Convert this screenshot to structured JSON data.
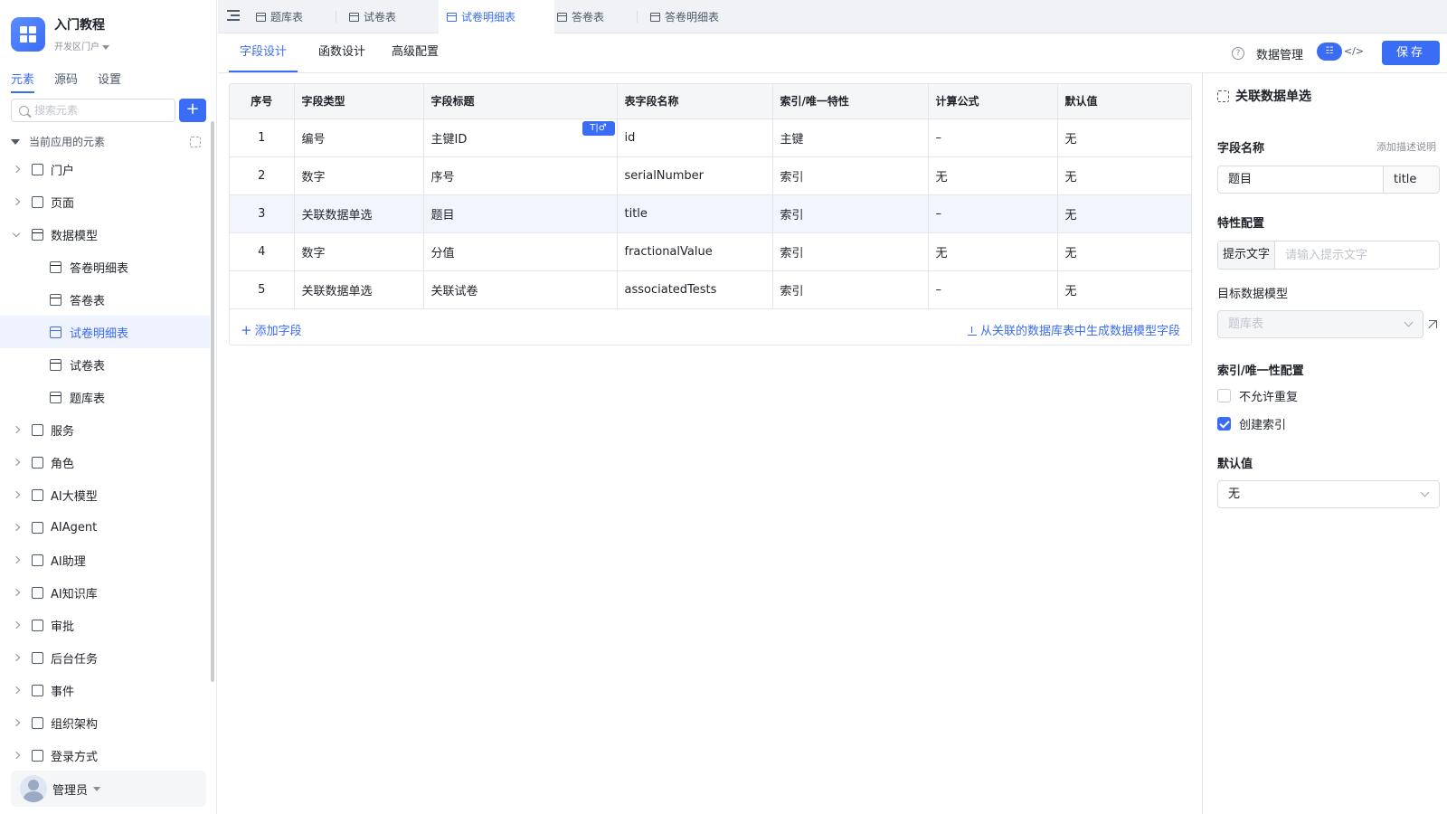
{
  "app": {
    "name": "入门教程",
    "portal": "开发区门户"
  },
  "sidebar": {
    "tabs": [
      "元素",
      "源码",
      "设置"
    ],
    "search_placeholder": "搜索元素",
    "add_label": "+",
    "section_title": "当前应用的元素",
    "items": [
      {
        "label": "门户"
      },
      {
        "label": "页面"
      },
      {
        "label": "数据模型"
      },
      {
        "label": "答卷明细表"
      },
      {
        "label": "答卷表"
      },
      {
        "label": "试卷明细表"
      },
      {
        "label": "试卷表"
      },
      {
        "label": "题库表"
      },
      {
        "label": "服务"
      },
      {
        "label": "角色"
      },
      {
        "label": "AI大模型"
      },
      {
        "label": "AIAgent"
      },
      {
        "label": "AI助理"
      },
      {
        "label": "AI知识库"
      },
      {
        "label": "审批"
      },
      {
        "label": "后台任务"
      },
      {
        "label": "事件"
      },
      {
        "label": "组织架构"
      },
      {
        "label": "登录方式"
      }
    ],
    "user": {
      "name": "管理员"
    }
  },
  "file_tabs": [
    "题库表",
    "试卷表",
    "试卷明细表",
    "答卷表",
    "答卷明细表"
  ],
  "sub_tabs": [
    "字段设计",
    "函数设计",
    "高级配置"
  ],
  "toolbar": {
    "help": "?",
    "data_manage": "数据管理",
    "toggle_on": "☷",
    "toggle_off": "</>",
    "save": "保存"
  },
  "table": {
    "headers": [
      "序号",
      "字段类型",
      "字段标题",
      "表字段名称",
      "索引/唯一特性",
      "计算公式",
      "默认值"
    ],
    "rows": [
      [
        "1",
        "编号",
        "主键ID",
        "id",
        "主键",
        "–",
        "无"
      ],
      [
        "2",
        "数字",
        "序号",
        "serialNumber",
        "索引",
        "无",
        "无"
      ],
      [
        "3",
        "关联数据单选",
        "题目",
        "title",
        "索引",
        "–",
        "无"
      ],
      [
        "4",
        "数字",
        "分值",
        "fractionalValue",
        "索引",
        "无",
        "无"
      ],
      [
        "5",
        "关联数据单选",
        "关联试卷",
        "associatedTests",
        "索引",
        "–",
        "无"
      ]
    ],
    "badge": "T|♂",
    "add_field": "添加字段",
    "generate": "从关联的数据库表中生成数据模型字段"
  },
  "panel": {
    "title": "关联数据单选",
    "field_name_label": "字段名称",
    "add_desc": "添加描述说明",
    "field_title": "题目",
    "field_key": "title",
    "feature_label": "特性配置",
    "hint_addon": "提示文字",
    "hint_placeholder": "请输入提示文字",
    "target_label": "目标数据模型",
    "target_value": "题库表",
    "index_label": "索引/唯一性配置",
    "no_dup": "不允许重复",
    "create_index": "创建索引",
    "default_label": "默认值",
    "default_value": "无"
  },
  "colors": {
    "accent": "#3b6cf6",
    "active_bg": "#eef3ff"
  }
}
